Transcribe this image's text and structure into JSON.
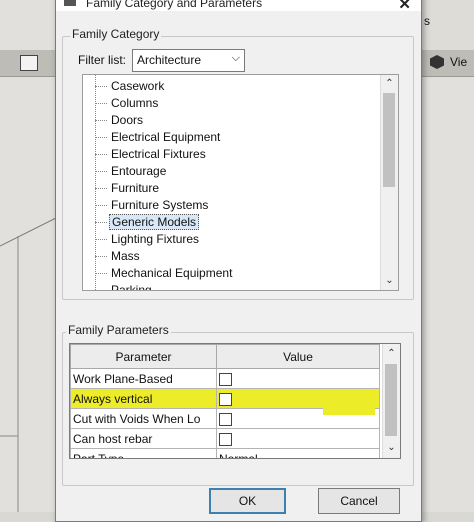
{
  "background_app": {
    "view_tab_label": "Vie",
    "top_right_text": "s"
  },
  "dialog": {
    "title": "Family Category and Parameters",
    "close_glyph": "✕",
    "category_group_label": "Family Category",
    "filter_label": "Filter list:",
    "filter_value": "Architecture",
    "categories": [
      "Casework",
      "Columns",
      "Doors",
      "Electrical Equipment",
      "Electrical Fixtures",
      "Entourage",
      "Furniture",
      "Furniture Systems",
      "Generic Models",
      "Lighting Fixtures",
      "Mass",
      "Mechanical Equipment",
      "Parking"
    ],
    "selected_category": "Generic Models",
    "parameters_group_label": "Family Parameters",
    "param_headers": {
      "parameter": "Parameter",
      "value": "Value"
    },
    "params": [
      {
        "name": "Work Plane-Based",
        "type": "checkbox",
        "value": ""
      },
      {
        "name": "Always vertical",
        "type": "checkbox",
        "value": "",
        "highlighted": true
      },
      {
        "name": "Cut with Voids When Lo",
        "type": "checkbox",
        "value": ""
      },
      {
        "name": "Can host rebar",
        "type": "checkbox",
        "value": ""
      },
      {
        "name": "Part Type",
        "type": "text",
        "value": "Normal"
      }
    ],
    "ok_label": "OK",
    "cancel_label": "Cancel"
  },
  "colors": {
    "highlight": "#ecec28",
    "selection": "#d9e8f7",
    "dialog_bg": "#f0f0f0"
  }
}
